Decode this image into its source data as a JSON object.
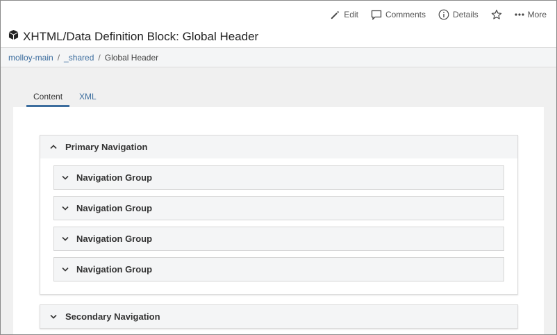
{
  "header": {
    "title": "XHTML/Data Definition Block: Global Header",
    "title_icon": "cube-icon",
    "actions": {
      "edit_label": "Edit",
      "comments_label": "Comments",
      "details_label": "Details",
      "more_label": "More"
    }
  },
  "breadcrumb": {
    "items": [
      "molloy-main",
      "_shared"
    ],
    "separator": "/",
    "current": "Global Header"
  },
  "tabs": [
    {
      "label": "Content",
      "active": true
    },
    {
      "label": "XML",
      "active": false
    }
  ],
  "sections": [
    {
      "label": "Primary Navigation",
      "expanded": true,
      "groups": [
        {
          "label": "Navigation Group"
        },
        {
          "label": "Navigation Group"
        },
        {
          "label": "Navigation Group"
        },
        {
          "label": "Navigation Group"
        }
      ]
    },
    {
      "label": "Secondary Navigation",
      "expanded": false
    }
  ],
  "colors": {
    "accent": "#3c6d9e",
    "panel_header": "#f4f5f6",
    "border": "#dcdcdc"
  }
}
